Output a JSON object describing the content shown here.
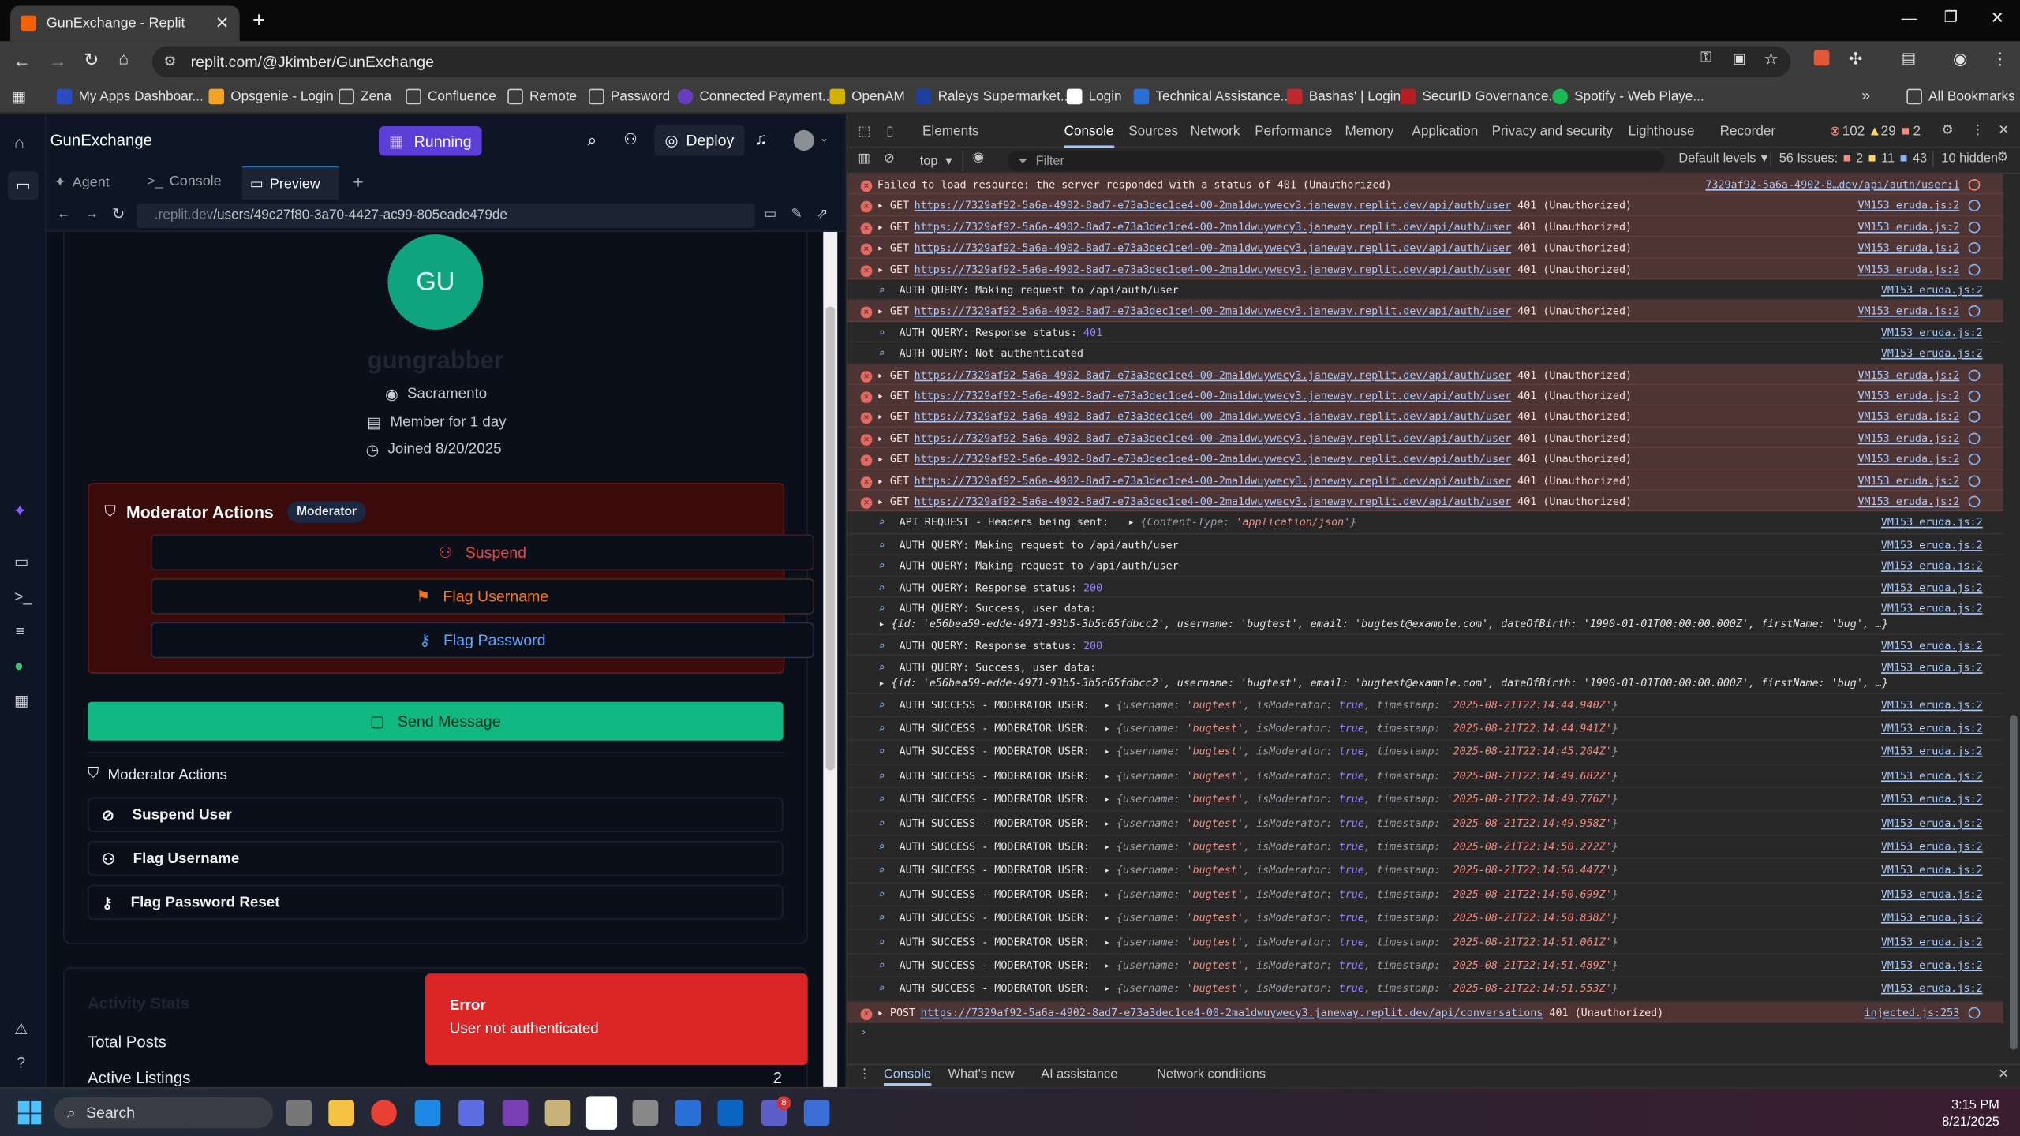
{
  "browser": {
    "tab_title": "GunExchange - Replit",
    "url": "replit.com/@Jkimber/GunExchange",
    "bookmarks": [
      "My Apps Dashboar...",
      "Opsgenie - Login",
      "Zena",
      "Confluence",
      "Remote",
      "Password",
      "Connected Payment...",
      "OpenAM",
      "Raleys Supermarket...",
      "Login",
      "Technical Assistance...",
      "Bashas' | Login",
      "SecurID Governance...",
      "Spotify - Web Playe..."
    ],
    "all_bookmarks": "All Bookmarks"
  },
  "replit": {
    "project": "GunExchange",
    "status": "Running",
    "deploy": "Deploy",
    "tabs": [
      "Agent",
      "Console",
      "Preview"
    ],
    "preview_url_prefix": ".replit.dev",
    "preview_url_path": "/users/49c27f80-3a70-4427-ac99-805eade479de"
  },
  "profile": {
    "initials": "GU",
    "username": "gungrabber",
    "location": "Sacramento",
    "member_for": "Member for 1 day",
    "joined": "Joined 8/20/2025"
  },
  "mod_box": {
    "title": "Moderator Actions",
    "badge": "Moderator",
    "suspend": "Suspend",
    "flag_username": "Flag Username",
    "flag_password": "Flag Password"
  },
  "send_message": "Send Message",
  "mod_list": {
    "title": "Moderator Actions",
    "items": [
      "Suspend User",
      "Flag Username",
      "Flag Password Reset"
    ]
  },
  "activity": {
    "title": "Activity Stats",
    "total_posts": "Total Posts",
    "active_listings": "Active Listings",
    "active_value": "2"
  },
  "toast": {
    "title": "Error",
    "message": "User not authenticated"
  },
  "devtools": {
    "tabs": [
      "Elements",
      "Console",
      "Sources",
      "Network",
      "Performance",
      "Memory",
      "Application",
      "Privacy and security",
      "Lighthouse",
      "Recorder"
    ],
    "errors": "102",
    "warnings": "29",
    "issues_count": "2",
    "context": "top",
    "filter": "Filter",
    "levels": "Default levels",
    "issues": "56 Issues:",
    "issue_counts": [
      "2",
      "11",
      "43"
    ],
    "hidden": "10 hidden",
    "bottom_tabs": [
      "Console",
      "What's new",
      "AI assistance",
      "Network conditions"
    ],
    "log": {
      "first": "Failed to load resource: the server responded with a status of 401 (Unauthorized)",
      "first_src": "7329af92-5a6a-4902-8…dev/api/auth/user:1",
      "get_url": "https://7329af92-5a6a-4902-8ad7-e73a3dec1ce4-00-2ma1dwuywecy3.janeway.replit.dev/api/auth/user",
      "status401": "401 (Unauthorized)",
      "src": "VM153 eruda.js:2",
      "making": "AUTH QUERY: Making request to /api/auth/user",
      "resp": "AUTH QUERY: Response status: ",
      "notauth": "AUTH QUERY: Not authenticated",
      "api_req": "API REQUEST - Headers being sent:",
      "success": "AUTH QUERY: Success, user data:",
      "mod_user": "AUTH SUCCESS - MODERATOR USER:",
      "user_obj": "{id: 'e56bea59-edde-4971-93b5-3b5c65fdbcc2', username: 'bugtest', email: 'bugtest@example.com', dateOfBirth: '1990-01-01T00:00:00.000Z', firstName: 'bug', …}",
      "timestamps": [
        "2025-08-21T22:14:44.940Z",
        "2025-08-21T22:14:44.941Z",
        "2025-08-21T22:14:45.204Z",
        "2025-08-21T22:14:49.682Z",
        "2025-08-21T22:14:49.776Z",
        "2025-08-21T22:14:49.958Z",
        "2025-08-21T22:14:50.272Z",
        "2025-08-21T22:14:50.447Z",
        "2025-08-21T22:14:50.699Z",
        "2025-08-21T22:14:50.838Z",
        "2025-08-21T22:14:51.061Z",
        "2025-08-21T22:14:51.489Z",
        "2025-08-21T22:14:51.553Z"
      ],
      "post_url": "https://7329af92-5a6a-4902-8ad7-e73a3dec1ce4-00-2ma1dwuywecy3.janeway.replit.dev/api/conversations",
      "post_src": "injected.js:253"
    }
  },
  "taskbar": {
    "search": "Search",
    "time": "3:15 PM",
    "date": "8/21/2025",
    "teams_badge": "8"
  }
}
